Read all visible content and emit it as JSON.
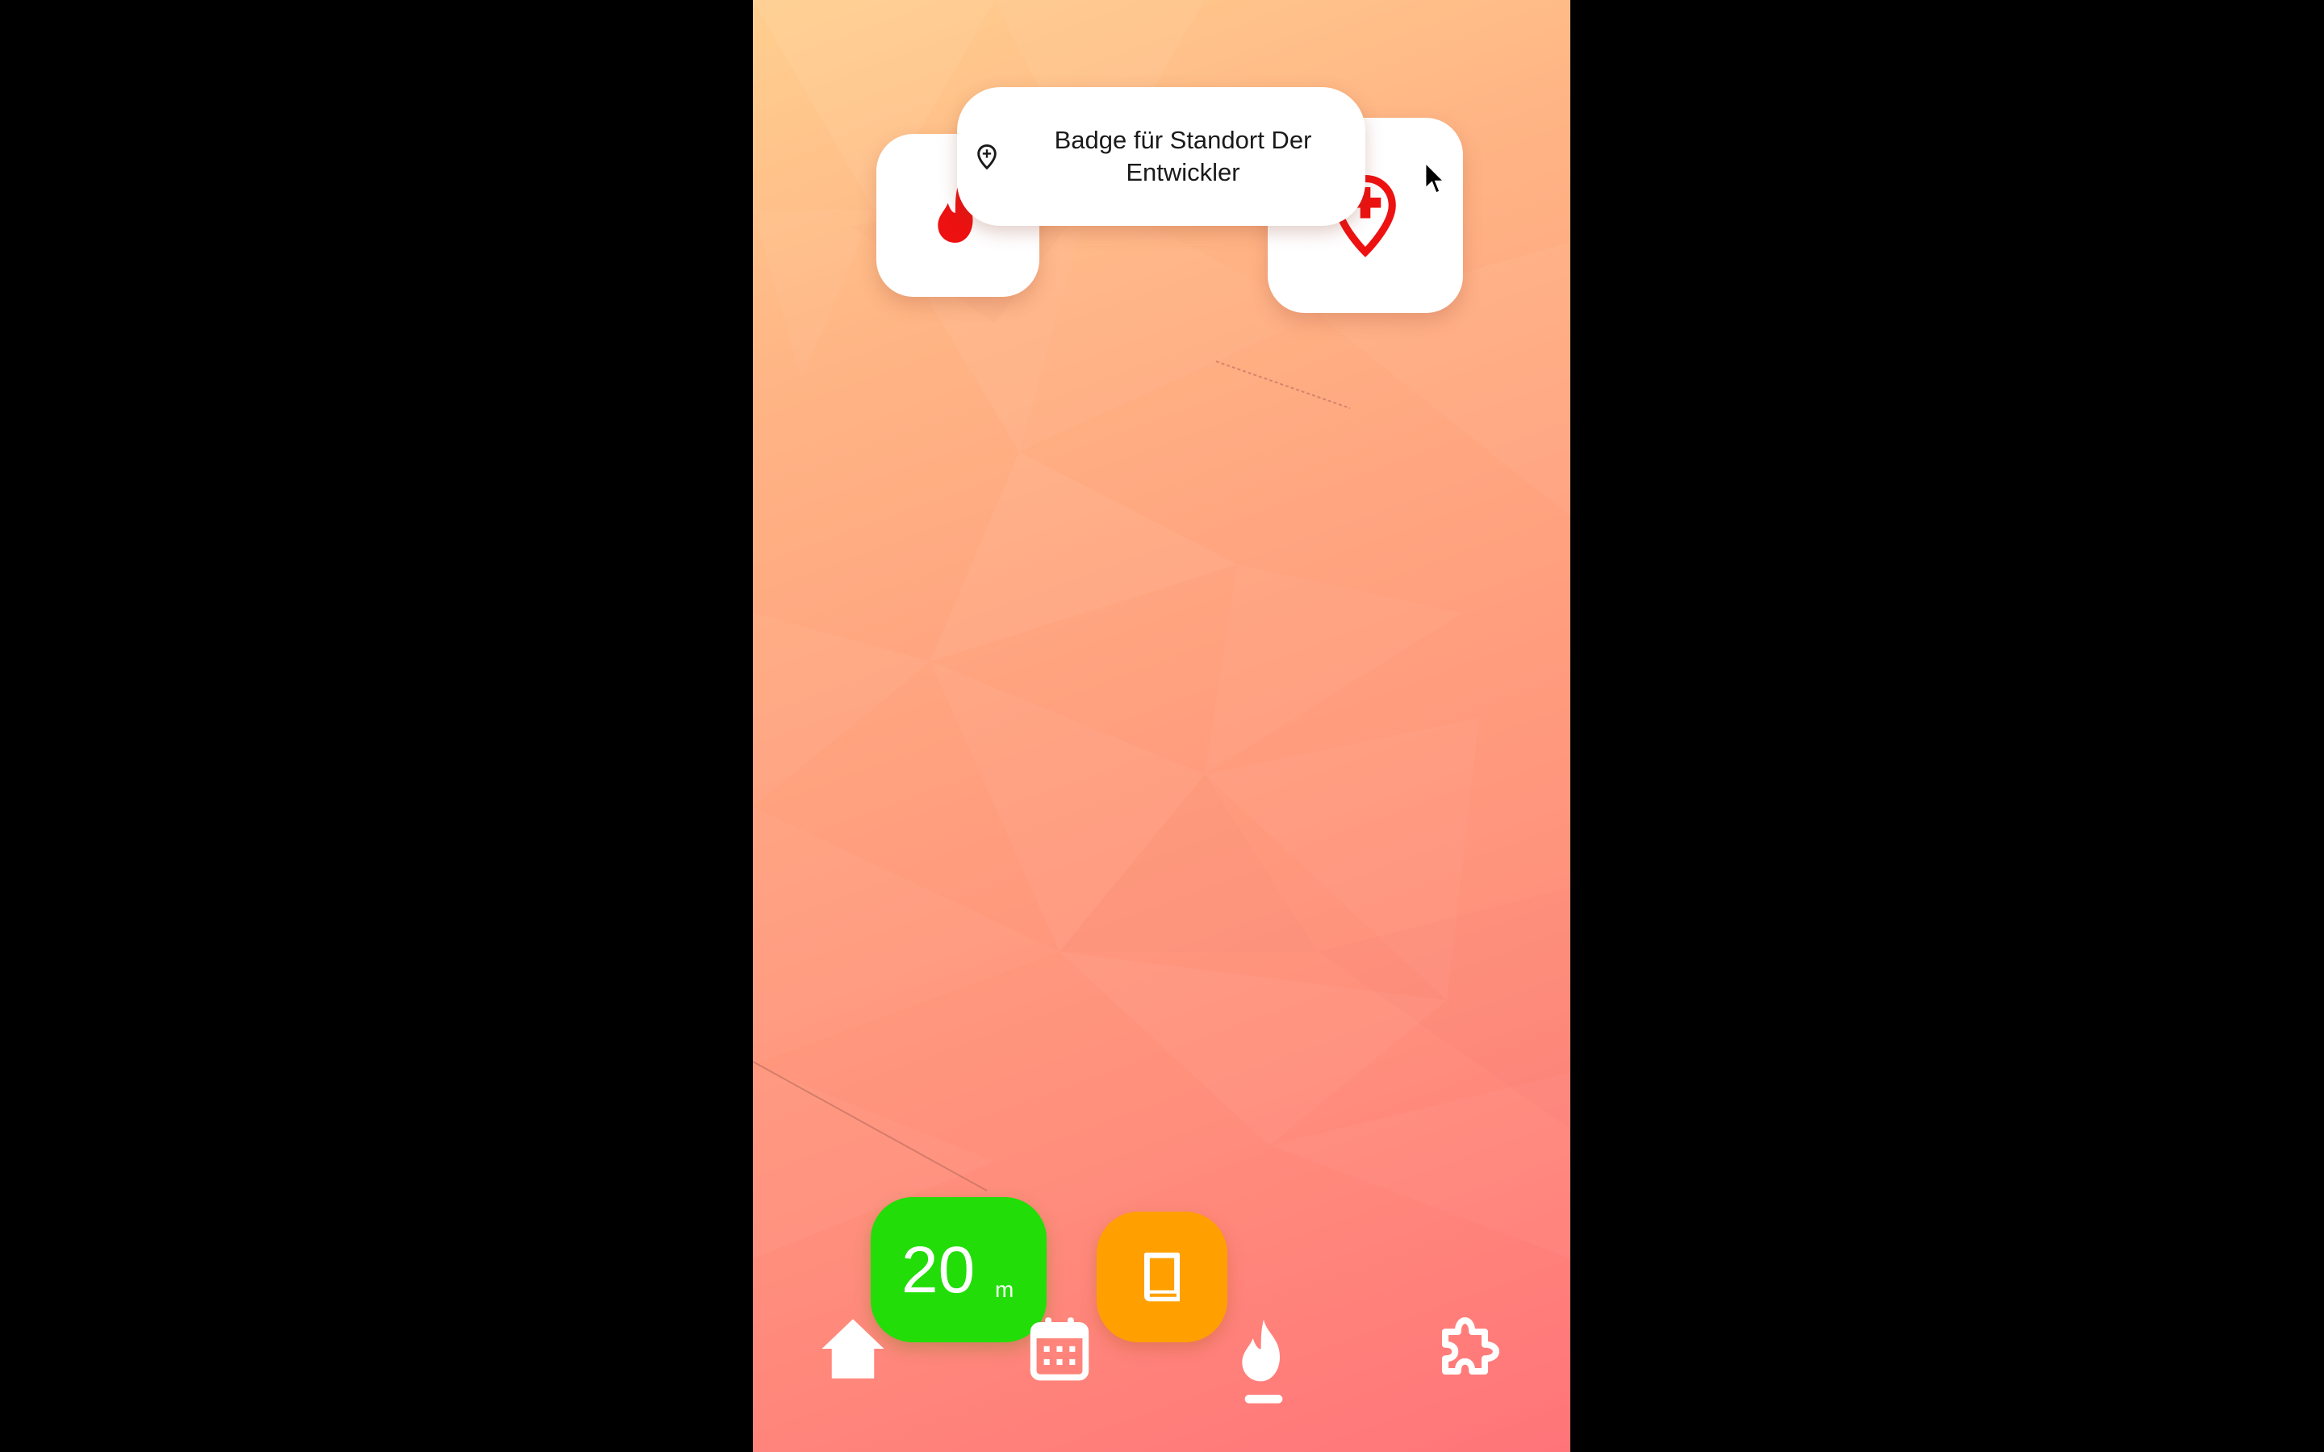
{
  "colors": {
    "background_top": "#ffcf8f",
    "background_bottom": "#ff7479",
    "badge_icon": "#ee1111",
    "timer_button": "#22dd08",
    "book_button": "#ffa000",
    "nav_icon": "#ffffff",
    "tooltip_text": "#1a1a1a"
  },
  "badges": [
    {
      "icon": "flame-icon"
    },
    {
      "icon": "location-plus-pin-icon"
    }
  ],
  "tooltip": {
    "icon": "location-plus-pin-icon",
    "text": "Badge für Standort Der Entwickler"
  },
  "timer": {
    "value": "20",
    "unit": "m"
  },
  "book_button": {
    "icon": "book-icon"
  },
  "nav": {
    "items": [
      {
        "id": "home",
        "icon": "home-icon",
        "active": false
      },
      {
        "id": "calendar",
        "icon": "calendar-icon",
        "active": false
      },
      {
        "id": "fire",
        "icon": "flame-icon",
        "active": true
      },
      {
        "id": "plugins",
        "icon": "puzzle-icon",
        "active": false
      }
    ]
  }
}
